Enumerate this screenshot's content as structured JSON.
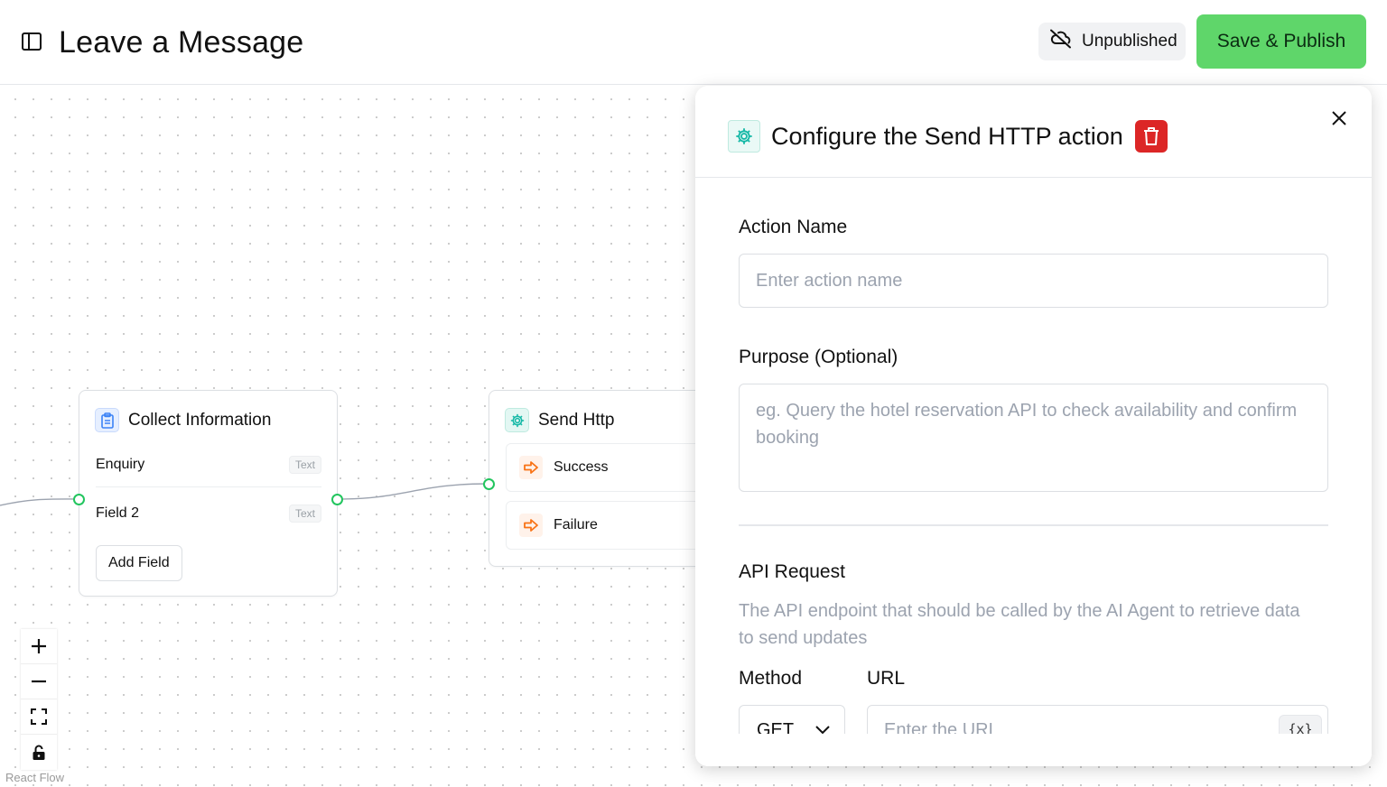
{
  "header": {
    "title": "Leave a Message",
    "status_label": "Unpublished",
    "publish_label": "Save & Publish"
  },
  "nodes": {
    "collect": {
      "title": "Collect Information",
      "fields": [
        {
          "label": "Enquiry",
          "type": "Text"
        },
        {
          "label": "Field 2",
          "type": "Text"
        }
      ],
      "add_label": "Add Field"
    },
    "http": {
      "title": "Send Http",
      "branches": [
        {
          "label": "Success"
        },
        {
          "label": "Failure"
        }
      ]
    }
  },
  "canvas": {
    "attribution": "React Flow",
    "controls": [
      "zoom-in",
      "zoom-out",
      "fit-view",
      "lock"
    ]
  },
  "panel": {
    "title": "Configure the Send HTTP action",
    "action_name_label": "Action Name",
    "action_name_placeholder": "Enter action name",
    "purpose_label": "Purpose (Optional)",
    "purpose_placeholder": "eg. Query the hotel reservation API to check availability and confirm booking",
    "api_request_label": "API Request",
    "api_request_help": "The API endpoint that should be called by the AI Agent to retrieve data to send updates",
    "method_label": "Method",
    "method_value": "GET",
    "url_label": "URL",
    "url_placeholder": "Enter the URL",
    "variable_button": "{x}"
  },
  "colors": {
    "accent_green": "#5fd66a",
    "handle_green": "#22c55e",
    "delete_red": "#dc2626",
    "teal_icon": "#14b8a6",
    "orange_icon": "#f97316"
  }
}
